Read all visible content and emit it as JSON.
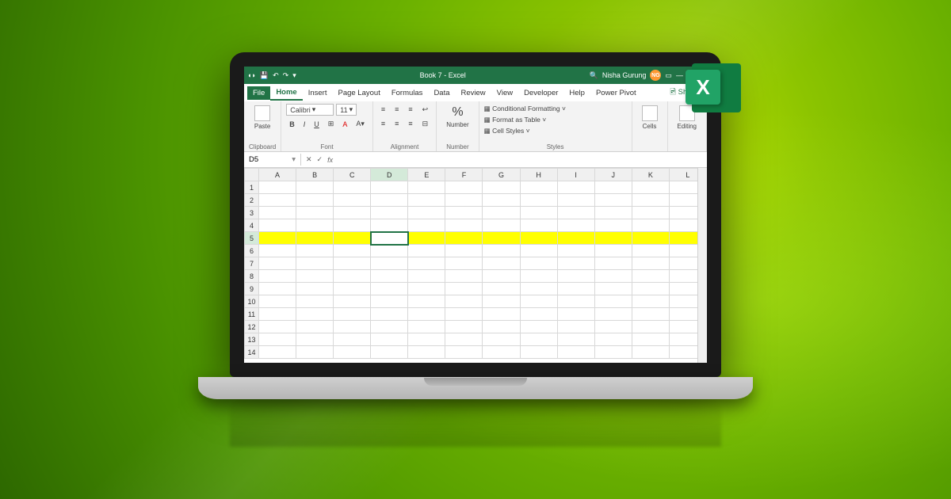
{
  "titlebar": {
    "doc_title": "Book 7 - Excel",
    "search_icon": "🔍",
    "user_name": "Nisha Gurung",
    "user_initials": "NG"
  },
  "tabs": {
    "file": "File",
    "home": "Home",
    "insert": "Insert",
    "page_layout": "Page Layout",
    "formulas": "Formulas",
    "data": "Data",
    "review": "Review",
    "view": "View",
    "developer": "Developer",
    "help": "Help",
    "power_pivot": "Power Pivot",
    "share": "🖻 Share"
  },
  "ribbon": {
    "clipboard": {
      "paste": "Paste",
      "label": "Clipboard"
    },
    "font": {
      "name": "Calibri",
      "size": "11",
      "label": "Font"
    },
    "alignment": {
      "label": "Alignment"
    },
    "number": {
      "btn": "Number",
      "label": "Number",
      "symbol": "%"
    },
    "styles": {
      "cond": "Conditional Formatting ˅",
      "fmt": "Format as Table ˅",
      "cell": "Cell Styles ˅",
      "label": "Styles"
    },
    "cells": {
      "btn": "Cells",
      "label": ""
    },
    "editing": {
      "btn": "Editing",
      "label": ""
    }
  },
  "formula": {
    "cell_ref": "D5",
    "fx": "fx"
  },
  "columns": [
    "A",
    "B",
    "C",
    "D",
    "E",
    "F",
    "G",
    "H",
    "I",
    "J",
    "K",
    "L"
  ],
  "rows": [
    "1",
    "2",
    "3",
    "4",
    "5",
    "6",
    "7",
    "8",
    "9",
    "10",
    "11",
    "12",
    "13",
    "14"
  ],
  "active_col": "D",
  "active_row": "5",
  "highlighted_row": "5",
  "selected_cell": {
    "col": "D",
    "row": "5"
  },
  "excel_logo": "X"
}
